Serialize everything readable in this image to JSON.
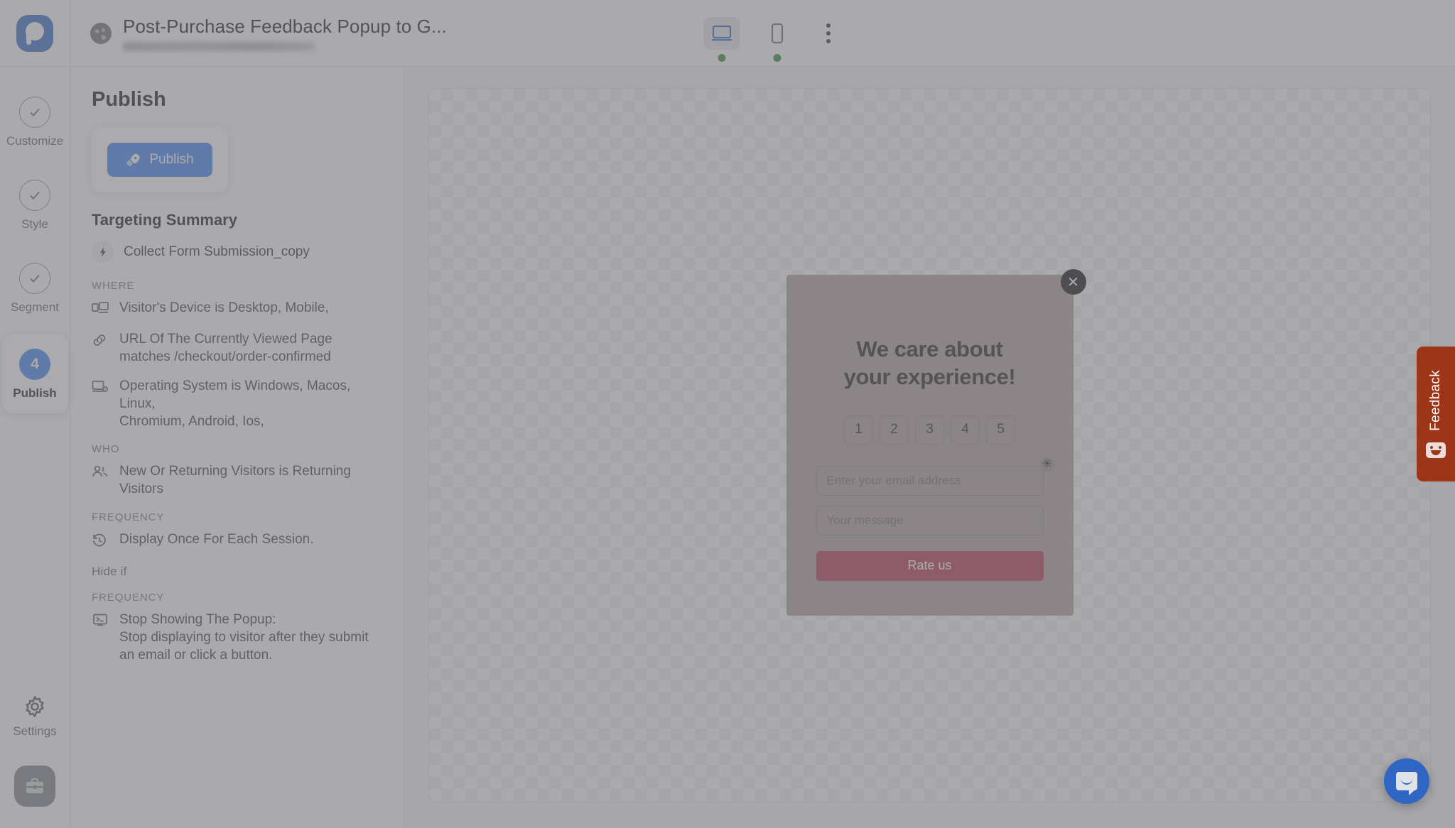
{
  "app": {
    "logo_icon": "popupsmart-logo-icon"
  },
  "header": {
    "site_icon": "globe-icon",
    "title": "Post-Purchase Feedback Popup to G...",
    "subtitle_redacted": "",
    "devices": [
      {
        "name": "desktop",
        "icon": "desktop-icon",
        "active": true,
        "status_dot": "green"
      },
      {
        "name": "mobile",
        "icon": "mobile-icon",
        "active": false,
        "status_dot": "green"
      }
    ],
    "more_menu_icon": "kebab-menu-icon"
  },
  "rail": {
    "steps": [
      {
        "label": "Customize",
        "icon": "check-circle-icon",
        "state": "complete"
      },
      {
        "label": "Style",
        "icon": "check-circle-icon",
        "state": "complete"
      },
      {
        "label": "Segment",
        "icon": "check-circle-icon",
        "state": "complete"
      },
      {
        "label": "Publish",
        "number": "4",
        "state": "active"
      }
    ],
    "settings": {
      "label": "Settings",
      "icon": "gear-icon"
    },
    "toolbox": {
      "icon": "briefcase-icon"
    }
  },
  "panel": {
    "heading": "Publish",
    "publish_button": {
      "label": "Publish",
      "icon": "rocket-icon"
    },
    "targeting_heading": "Targeting Summary",
    "goal": {
      "label": "Collect Form Submission_copy",
      "icon": "bolt-icon"
    },
    "sections": [
      {
        "label": "WHERE",
        "rules": [
          {
            "icon": "device-icon",
            "text": "Visitor's Device is Desktop, Mobile,"
          },
          {
            "icon": "link-icon",
            "text": "URL Of The Currently Viewed Page",
            "sub": "matches /checkout/order-confirmed"
          },
          {
            "icon": "os-icon",
            "text": "Operating System is Windows, Macos, Linux,",
            "sub": "Chromium, Android, Ios,"
          }
        ]
      },
      {
        "label": "WHO",
        "rules": [
          {
            "icon": "users-icon",
            "text": "New Or Returning Visitors is Returning Visitors"
          }
        ]
      },
      {
        "label": "FREQUENCY",
        "rules": [
          {
            "icon": "history-icon",
            "text": "Display Once For Each Session."
          }
        ]
      }
    ],
    "hide_if_label": "Hide if",
    "hide_if_section": {
      "label": "FREQUENCY",
      "rules": [
        {
          "icon": "stop-display-icon",
          "text": "Stop Showing The Popup:",
          "sub": "Stop displaying to visitor after they submit an email or click a button."
        }
      ]
    }
  },
  "popup": {
    "close_icon": "close-icon",
    "title_line1": "We care about",
    "title_line2": "your experience!",
    "rating_options": [
      "1",
      "2",
      "3",
      "4",
      "5"
    ],
    "email_placeholder": "Enter your email address",
    "email_value": "",
    "required_marker": "✳",
    "message_placeholder": "Your message",
    "message_value": "",
    "submit_label": "Rate us",
    "colors": {
      "background": "#ab9c9c",
      "submit": "#b2304a",
      "title": "#1b1b1b"
    }
  },
  "feedback_tab": {
    "label": "Feedback",
    "icon": "smiley-box-icon",
    "color": "#9e3418"
  },
  "chat_launcher": {
    "icon": "chat-bubble-icon",
    "color": "#2f66c4"
  }
}
